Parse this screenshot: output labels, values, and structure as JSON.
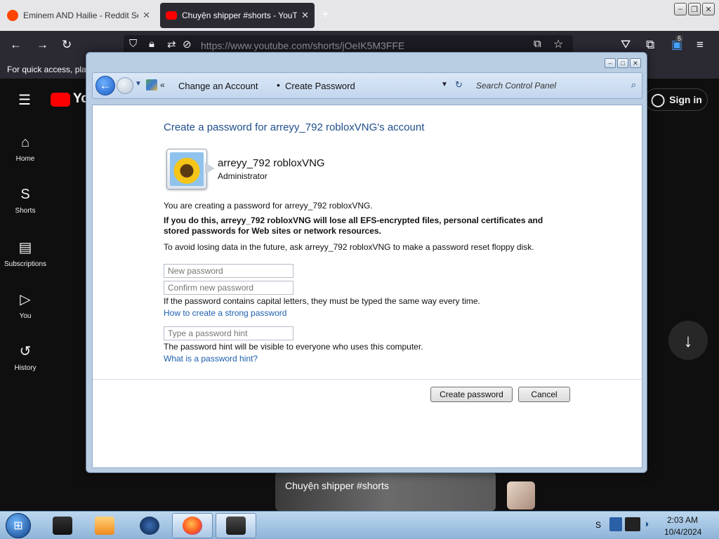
{
  "browser": {
    "tabs": [
      {
        "title": "Eminem AND Hailie - Reddit Se",
        "close": "✕"
      },
      {
        "title": "Chuyện shipper #shorts - YouTu",
        "close": "✕"
      }
    ],
    "new_tab": "+",
    "url": "https://www.youtube.com/shorts/jOeIK5M3FFE",
    "bookmarks_hint": "For quick access, plac",
    "extension_badge": "5"
  },
  "youtube": {
    "logo_text": "You",
    "sidebar": [
      {
        "label": "Home",
        "icon": "⌂"
      },
      {
        "label": "Shorts",
        "icon": "S"
      },
      {
        "label": "Subscriptions",
        "icon": "▤"
      },
      {
        "label": "You",
        "icon": "▷"
      },
      {
        "label": "History",
        "icon": "↺"
      }
    ],
    "sign_in": "Sign in",
    "short_title": "Chuyện shipper #shorts"
  },
  "control_panel": {
    "breadcrumb": [
      "Change an Account",
      "Create Password"
    ],
    "breadcrumb_sep": "•",
    "search_placeholder": "Search Control Panel",
    "heading": "Create a password for arreyy_792 robloxVNG's account",
    "user_name": "arreyy_792 robloxVNG",
    "user_role": "Administrator",
    "creating_text": "You are creating a password for arreyy_792 robloxVNG.",
    "warning_text": "If you do this, arreyy_792 robloxVNG will lose all EFS-encrypted files, personal certificates and stored passwords for Web sites or network resources.",
    "avoid_text": "To avoid losing data in the future, ask arreyy_792 robloxVNG to make a password reset floppy disk.",
    "new_password_placeholder": "New password",
    "confirm_password_placeholder": "Confirm new password",
    "caps_text": "If the password contains capital letters, they must be typed the same way every time.",
    "strong_password_link": "How to create a strong password",
    "hint_placeholder": "Type a password hint",
    "hint_visible_text": "The password hint will be visible to everyone who uses this computer.",
    "what_is_hint_link": "What is a password hint?",
    "create_button": "Create password",
    "cancel_button": "Cancel"
  },
  "taskbar": {
    "time": "2:03 AM",
    "date": "10/4/2024"
  }
}
